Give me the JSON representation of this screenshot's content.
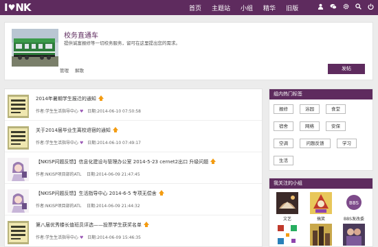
{
  "topbar": {
    "logo_left": "I",
    "logo_right": "NK",
    "nav": [
      "首页",
      "主题站",
      "小组",
      "精华",
      "旧版"
    ],
    "icons": [
      "user-icon",
      "chat-icon",
      "gear-icon",
      "search-icon",
      "power-icon"
    ]
  },
  "group": {
    "title": "校务直通车",
    "description": "提供诚富报修等一切校务服务，留可在这里提出您的需求。",
    "links": [
      "管理",
      "解散"
    ],
    "post_button": "发帖"
  },
  "posts": [
    {
      "title": "2014年暑期学生报迁的通知",
      "author": "作者:学生生活指导中心",
      "date": "日期:2014-06-10 07:50:58",
      "thumb": "notice-board"
    },
    {
      "title": "关于2014届毕业生离校退宿的通知",
      "author": "作者:学生生活指导中心",
      "date": "日期:2014-06-10 07:49:17",
      "thumb": "notice-board"
    },
    {
      "title": "【NKISP问题反馈】信息化建设与管理办公室 2014-5-23 cernet2出口 升级问题",
      "author": "作者:NKISP项目部的ATL",
      "date": "日期:2014-06-09 21:47:45",
      "thumb": "anime-girl"
    },
    {
      "title": "【NKISP问题反馈】生活指导中心 2014-6-5 专项无偿舍",
      "author": "作者:NKISP项目部的ATL",
      "date": "日期:2014-06-09 21:44:32",
      "thumb": "anime-girl"
    },
    {
      "title": "第八届优秀楼长值班员评选——投票学生获奖名单",
      "author": "作者:学生生活指导中心",
      "date": "日期:2014-06-09 15:46:35",
      "thumb": "notice-board"
    }
  ],
  "hot_tags": {
    "heading": "组内热门标签",
    "tags": [
      "报修",
      "浴园",
      "食堂",
      "宿舍",
      "网络",
      "安保",
      "空调",
      "问题反馈",
      "学习",
      "生活"
    ]
  },
  "my_groups": {
    "heading": "我关注的小组",
    "items": [
      {
        "label": "文艺"
      },
      {
        "label": "搞笑"
      },
      {
        "label": "BBS发改委"
      },
      {
        "label": ""
      },
      {
        "label": ""
      },
      {
        "label": ""
      }
    ]
  },
  "colors": {
    "brand": "#5e2b5e",
    "accent": "#f39c12"
  }
}
